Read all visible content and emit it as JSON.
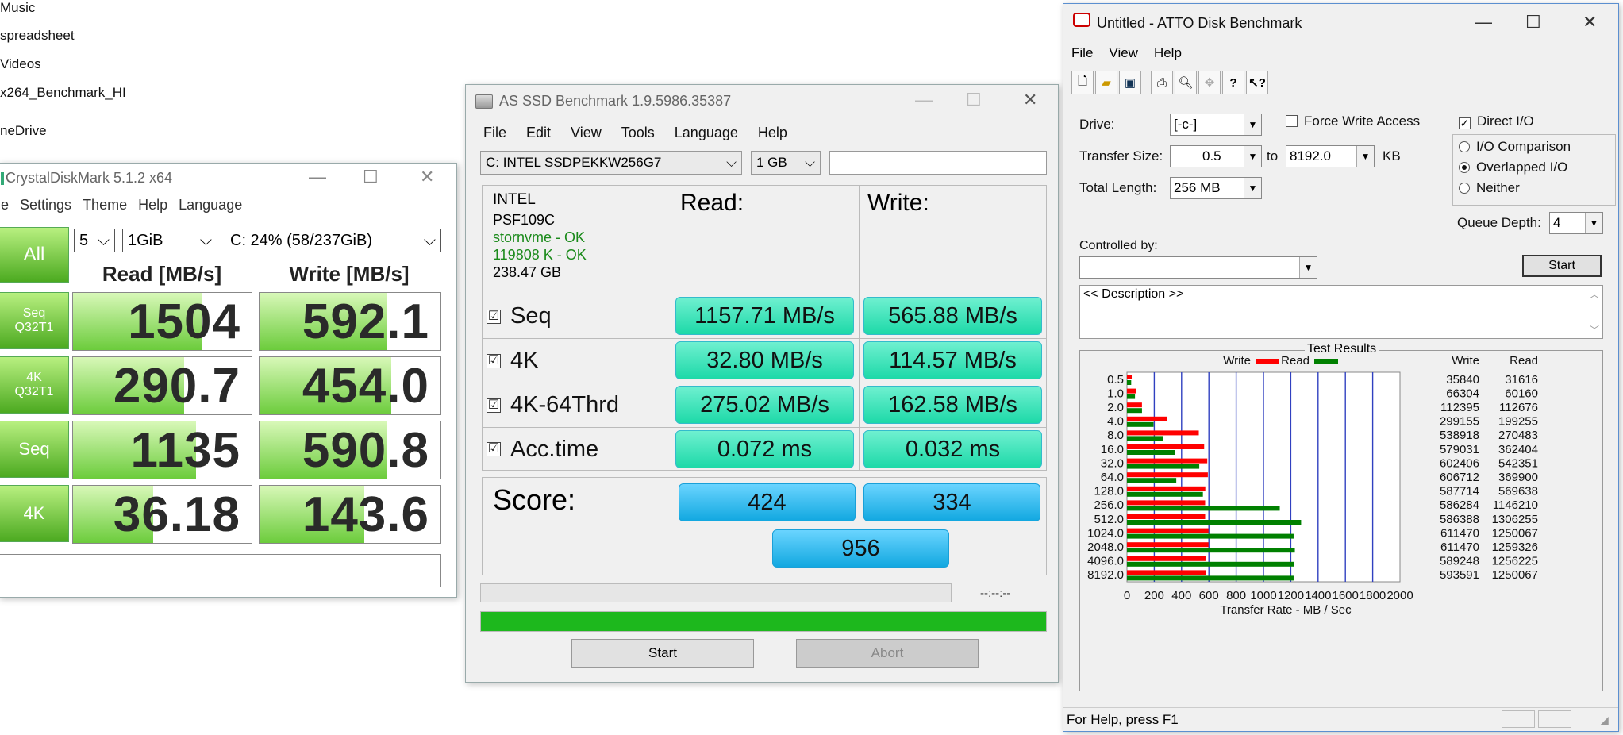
{
  "desktop": {
    "items": [
      "Music",
      "spreadsheet",
      "Videos",
      "x264_Benchmark_HI",
      "neDrive"
    ]
  },
  "cdm": {
    "title": "CrystalDiskMark 5.1.2 x64",
    "menu": [
      "e",
      "Settings",
      "Theme",
      "Help",
      "Language"
    ],
    "all_button": "All",
    "count": "5",
    "size": "1GiB",
    "drive": "C: 24% (58/237GiB)",
    "read_header": "Read [MB/s]",
    "write_header": "Write [MB/s]",
    "rows": [
      {
        "label1": "Seq",
        "label2": "Q32T1",
        "read": "1504",
        "write": "592.1",
        "read_frac": 0.72,
        "write_frac": 0.7
      },
      {
        "label1": "4K",
        "label2": "Q32T1",
        "read": "290.7",
        "write": "454.0",
        "read_frac": 0.62,
        "write_frac": 0.73
      },
      {
        "label1": "Seq",
        "label2": "",
        "read": "1135",
        "write": "590.8",
        "read_frac": 0.69,
        "write_frac": 0.7
      },
      {
        "label1": "4K",
        "label2": "",
        "read": "36.18",
        "write": "143.6",
        "read_frac": 0.45,
        "write_frac": 0.58
      }
    ],
    "colors": {
      "accent": "#4caa20"
    }
  },
  "asssd": {
    "title": "AS SSD Benchmark 1.9.5986.35387",
    "menu": [
      "File",
      "Edit",
      "View",
      "Tools",
      "Language",
      "Help"
    ],
    "drive": "C: INTEL SSDPEKKW256G7",
    "size": "1 GB",
    "info": {
      "vendor": "INTEL",
      "firmware": "PSF109C",
      "driver": "stornvme - OK",
      "align": "119808 K - OK",
      "capacity": "238.47 GB"
    },
    "read_header": "Read:",
    "write_header": "Write:",
    "rows": [
      {
        "label": "Seq",
        "read": "1157.71 MB/s",
        "write": "565.88 MB/s",
        "checked": "☑"
      },
      {
        "label": "4K",
        "read": "32.80 MB/s",
        "write": "114.57 MB/s",
        "checked": "☑"
      },
      {
        "label": "4K-64Thrd",
        "read": "275.02 MB/s",
        "write": "162.58 MB/s",
        "checked": "☑"
      },
      {
        "label": "Acc.time",
        "read": "0.072 ms",
        "write": "0.032 ms",
        "checked": "☑"
      }
    ],
    "score_label": "Score:",
    "score_read": "424",
    "score_write": "334",
    "score_total": "956",
    "time": "--:--:--",
    "progress_fraction": 1.0,
    "start_button": "Start",
    "abort_button": "Abort",
    "colors": {
      "result": "#1dd9a8",
      "score": "#12a8e0",
      "progress": "#1db81d"
    }
  },
  "atto": {
    "title": "Untitled - ATTO Disk Benchmark",
    "menu": [
      "File",
      "View",
      "Help"
    ],
    "drive_label": "Drive:",
    "drive_value": "[-c-]",
    "force_write": "Force Write Access",
    "direct_io": "Direct I/O",
    "transfer_label": "Transfer Size:",
    "transfer_from": "0.5",
    "to_label": "to",
    "transfer_to": "8192.0",
    "kb_label": "KB",
    "total_label": "Total Length:",
    "total_value": "256 MB",
    "io_comparison": "I/O Comparison",
    "overlapped": "Overlapped I/O",
    "neither": "Neither",
    "queue_label": "Queue Depth:",
    "queue_value": "4",
    "controlled_label": "Controlled by:",
    "start_button": "Start",
    "description": "<< Description >>",
    "results_title": "Test Results",
    "legend_write": "Write",
    "legend_read": "Read",
    "col_write": "Write",
    "col_read": "Read",
    "xlabel": "Transfer Rate - MB / Sec",
    "status": "For Help, press F1"
  },
  "chart_data": {
    "type": "bar",
    "title": "Test Results",
    "xlabel": "Transfer Rate - MB / Sec",
    "ylabel": "",
    "xlim": [
      0,
      2000
    ],
    "xticks": [
      "0",
      "200",
      "400",
      "600",
      "800",
      "1000",
      "1200",
      "1400",
      "1600",
      "1800",
      "2000"
    ],
    "categories": [
      "0.5",
      "1.0",
      "2.0",
      "4.0",
      "8.0",
      "16.0",
      "32.0",
      "64.0",
      "128.0",
      "256.0",
      "512.0",
      "1024.0",
      "2048.0",
      "4096.0",
      "8192.0"
    ],
    "series": [
      {
        "name": "Write",
        "color": "#ff0000",
        "values": [
          35840,
          66304,
          112395,
          299155,
          538918,
          579031,
          602406,
          606712,
          587714,
          586284,
          586388,
          611470,
          611470,
          589248,
          593591
        ]
      },
      {
        "name": "Read",
        "color": "#008000",
        "values": [
          31616,
          60160,
          112676,
          199255,
          270483,
          362404,
          542351,
          369900,
          569638,
          1146210,
          1306255,
          1250067,
          1259326,
          1256225,
          1250067
        ]
      }
    ],
    "value_units": "KB/s",
    "grid": true,
    "legend": "top"
  }
}
